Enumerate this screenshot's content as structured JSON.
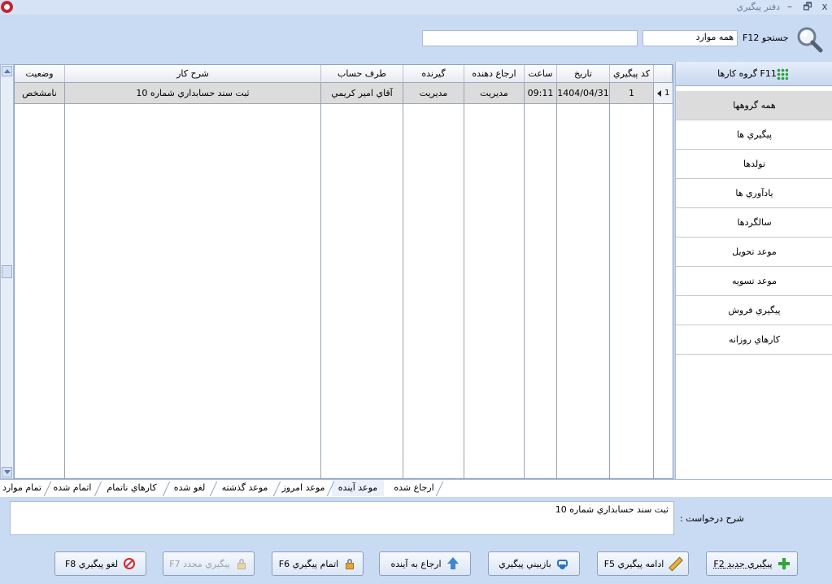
{
  "window": {
    "title": "دفتر پيگيري",
    "close": "x",
    "restore": "🗗",
    "minimize": "–"
  },
  "search": {
    "label": "جستجو F12",
    "filter_value": "همه موارد",
    "query_value": ""
  },
  "table": {
    "headers": {
      "code": "كد پيگيري",
      "date": "تاريخ",
      "time": "ساعت",
      "referrer": "ارجاع دهنده",
      "receiver": "گيرنده",
      "account": "طرف حساب",
      "description": "شرح كار",
      "status": "وضعيت"
    },
    "rows": [
      {
        "row_number": "1",
        "code": "1",
        "date": "1404/04/31",
        "time": "09:11",
        "referrer": "مديريت",
        "receiver": "مديريت",
        "account": "آقاي امير  كريمي",
        "description": "ثبت سند حسابداري شماره 10",
        "status": "نامشخص"
      }
    ]
  },
  "groups": {
    "header": "F11 گروه كارها",
    "items": [
      "همه گروهها",
      "پيگيري ها",
      "تولدها",
      "يادآوري ها",
      "سالگردها",
      "موعد تحويل",
      "موعد تسويه",
      "پيگيري فروش",
      "كارهاي روزانه"
    ],
    "selected_index": 0
  },
  "tabs": {
    "items": [
      "ارجاع شده",
      "موعد آينده",
      "موعد امروز",
      "موعد گذشته",
      "لغو شده",
      "كارهاي ناتمام",
      "اتمام شده",
      "تمام موارد"
    ],
    "active_index": 1
  },
  "description": {
    "label": "شرح درخواست :",
    "value": "ثبت سند حسابداري شماره 10"
  },
  "buttons": {
    "new": "پيگيري جديد F2",
    "continue": "ادامه پيگيري F5",
    "review": "بازبيني پيگيري",
    "refer_future": "ارجاع به آينده",
    "complete": "اتمام پيگيري F6",
    "repeat": "پيگيري مجدد F7",
    "cancel": "لغو پيگيري F8"
  },
  "icons": {
    "app": "app-logo-icon",
    "search": "magnifier-icon",
    "groups": "grid-icon"
  }
}
